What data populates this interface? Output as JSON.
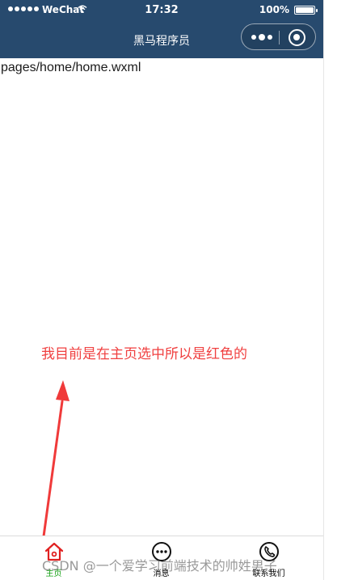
{
  "status_bar": {
    "carrier": "WeChat",
    "time": "17:32",
    "battery": "100%"
  },
  "nav": {
    "title": "黑马程序员"
  },
  "content": {
    "page_path": "pages/home/home.wxml",
    "annotation": "我目前是在主页选中所以是红色的"
  },
  "tabbar": {
    "items": [
      {
        "label": "主页",
        "icon": "home-icon",
        "selected": true
      },
      {
        "label": "消息",
        "icon": "message-icon",
        "selected": false
      },
      {
        "label": "联系我们",
        "icon": "phone-icon",
        "selected": false
      }
    ]
  },
  "watermark": "CSDN @一个爱学习前端技术的帅姓男子",
  "colors": {
    "nav_background": "#274a6e",
    "selected_tab_icon": "#e02020",
    "selected_tab_label": "#13a013",
    "annotation": "#f04040"
  }
}
